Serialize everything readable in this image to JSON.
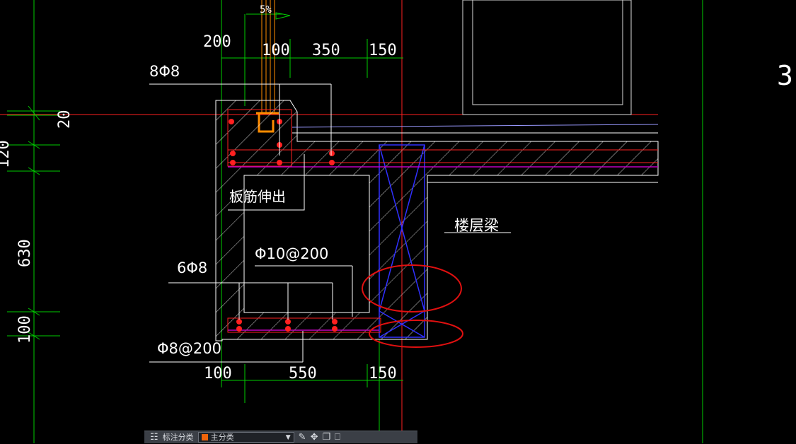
{
  "drawing": {
    "slope_label": "5%",
    "dims_top": [
      "200",
      "100",
      "350",
      "150"
    ],
    "dims_bottom": [
      "100",
      "550",
      "150"
    ],
    "dims_left": [
      "20",
      "120",
      "630",
      "100"
    ],
    "grid_mark": "3",
    "callout_top_rebar": "8Φ8",
    "callout_slab_extend": "板筋伸出",
    "callout_stirrup": "Φ10@200",
    "callout_bottom_bars": "6Φ8",
    "callout_bottom_dist": "Φ8@200",
    "callout_beam": "楼层梁"
  },
  "toolbar": {
    "layer_label": "标注分类",
    "layer_value": "主分类",
    "icons": [
      "layers-icon",
      "edit-icon",
      "move-icon",
      "copy-icon",
      "delete-icon"
    ]
  },
  "colors": {
    "background": "#000000",
    "grid_green": "#00ff00",
    "axis_red": "#ff2020",
    "beam_blue": "#2020ff",
    "rebar_red": "#ff0000",
    "gutter_orange": "#ff8c00",
    "highlight_circle": "#e01010",
    "magenta": "#c000c0"
  }
}
